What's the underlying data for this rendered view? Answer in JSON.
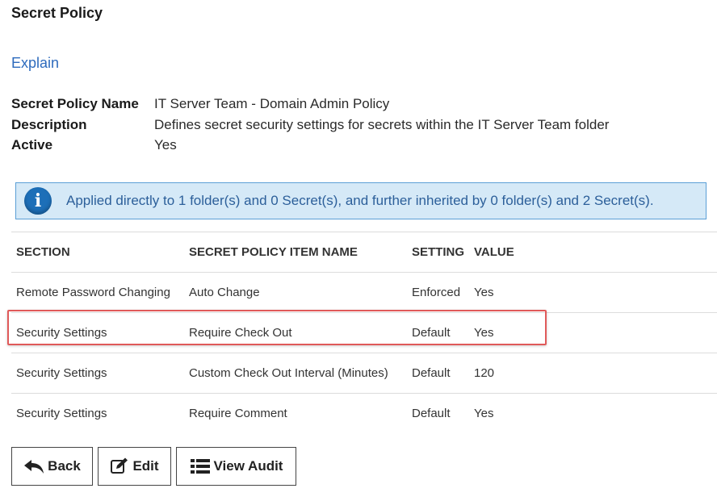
{
  "page": {
    "title": "Secret Policy",
    "explain_link": "Explain"
  },
  "properties": [
    {
      "label": "Secret Policy Name",
      "value": "IT Server Team - Domain Admin Policy"
    },
    {
      "label": "Description",
      "value": "Defines secret security settings for secrets within the IT Server Team folder"
    },
    {
      "label": "Active",
      "value": "Yes"
    }
  ],
  "info": {
    "icon": "info-icon",
    "text": "Applied directly to 1 folder(s) and 0 Secret(s), and further inherited by 0 folder(s) and 2 Secret(s)."
  },
  "table": {
    "headers": [
      "SECTION",
      "SECRET POLICY ITEM NAME",
      "SETTING",
      "VALUE"
    ],
    "rows": [
      [
        "Remote Password Changing",
        "Auto Change",
        "Enforced",
        "Yes"
      ],
      [
        "Security Settings",
        "Require Check Out",
        "Default",
        "Yes"
      ],
      [
        "Security Settings",
        "Custom Check Out Interval (Minutes)",
        "Default",
        "120"
      ],
      [
        "Security Settings",
        "Require Comment",
        "Default",
        "Yes"
      ]
    ],
    "highlight_color": "#e05a5a"
  },
  "buttons": {
    "back": {
      "label": "Back",
      "icon": "reply-arrow-icon"
    },
    "edit": {
      "label": "Edit",
      "icon": "edit-icon"
    },
    "view_audit": {
      "label": "View Audit",
      "icon": "list-icon"
    }
  },
  "colors": {
    "link": "#2e6bbd",
    "info_bg": "#d5e9f7",
    "info_border": "#5b9fd6",
    "info_icon": "#1d6fb8"
  }
}
